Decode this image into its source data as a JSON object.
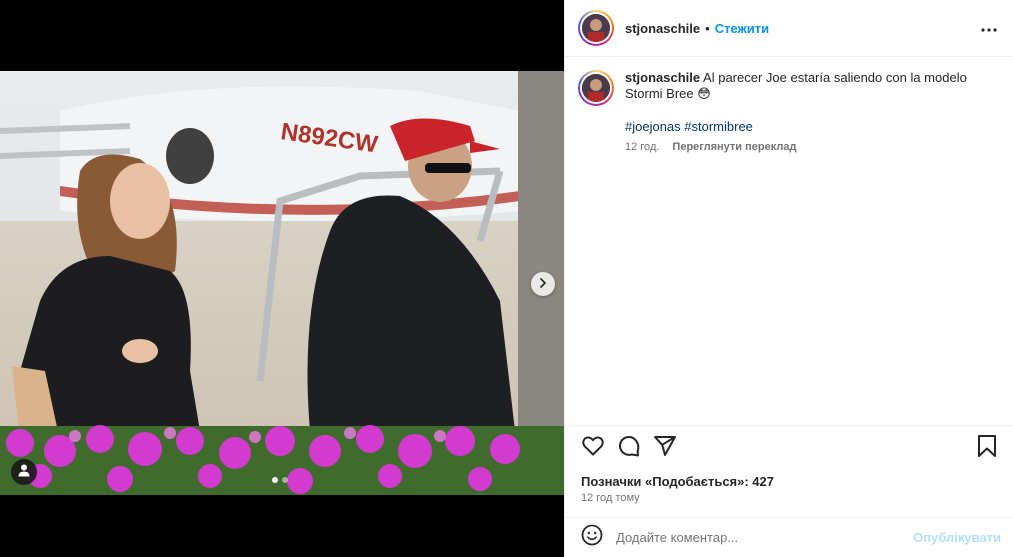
{
  "post": {
    "username": "stjonaschile",
    "separator": "•",
    "follow_label": "Стежити",
    "more_icon": "more-horizontal-icon"
  },
  "caption": {
    "username": "stjonaschile",
    "text": "Al parecer Joe estaría saliendo con la modelo Stormi Bree 😳",
    "hashtags": "#joejonas #stormibree",
    "age": "12 год.",
    "translate_label": "Переглянути переклад"
  },
  "actions": {
    "like_icon": "heart-icon",
    "comment_icon": "comment-icon",
    "share_icon": "send-icon",
    "save_icon": "bookmark-icon"
  },
  "likes_text": "Позначки «Подобається»: 427",
  "time_text": "12 год тому",
  "comment": {
    "placeholder": "Додайте коментар...",
    "post_label": "Опублікувати"
  },
  "carousel": {
    "slide_count": 2,
    "active_index": 0
  },
  "colors": {
    "accent": "#0095f6",
    "hashtag": "#00376b",
    "muted": "#737373",
    "post_disabled": "#b2dffc"
  }
}
